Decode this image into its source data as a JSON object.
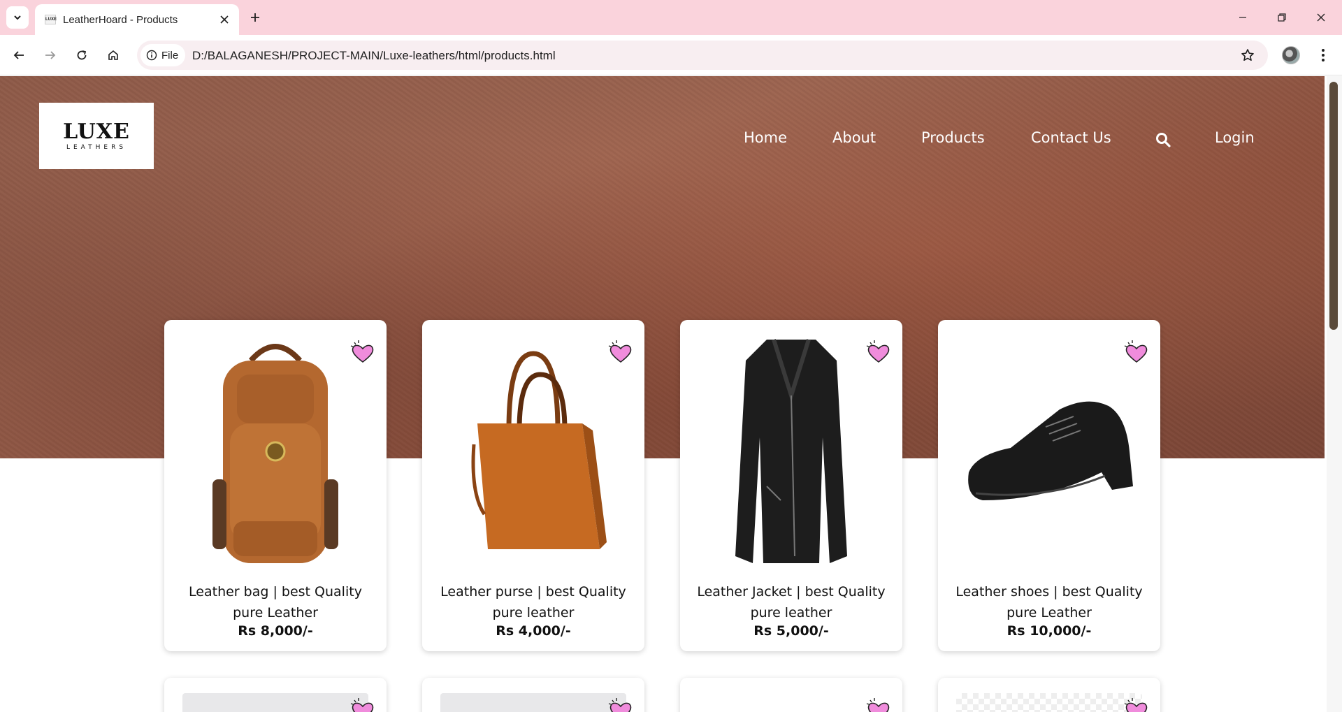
{
  "browser": {
    "tab_title": "LeatherHoard - Products",
    "favicon_text": "LUXE",
    "file_chip_label": "File",
    "url": "D:/BALAGANESH/PROJECT-MAIN/Luxe-leathers/html/products.html"
  },
  "site": {
    "logo_main": "LUXE",
    "logo_sub": "LEATHERS",
    "nav": [
      "Home",
      "About",
      "Products",
      "Contact Us",
      "Login"
    ]
  },
  "products": [
    {
      "title": "Leather bag | best Quality pure Leather",
      "price": "Rs 8,000/-",
      "image_icon": "backpack"
    },
    {
      "title": "Leather purse | best Quality pure leather",
      "price": "Rs 4,000/-",
      "image_icon": "tote-bag"
    },
    {
      "title": "Leather Jacket | best Quality pure leather",
      "price": "Rs 5,000/-",
      "image_icon": "jacket"
    },
    {
      "title": "Leather shoes | best Quality pure Leather",
      "price": "Rs 10,000/-",
      "image_icon": "shoe"
    }
  ],
  "colors": {
    "tab_strip": "#fad3dc",
    "heart": "#f08cdc",
    "leather_brown": "#b4682f"
  }
}
